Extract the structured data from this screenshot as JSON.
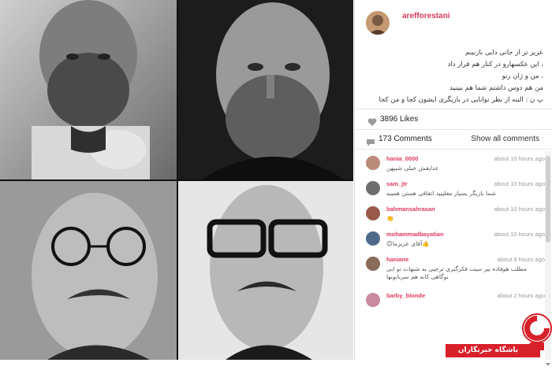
{
  "post": {
    "username": "arefforestani",
    "caption_lines": [
      "عزیز تر از جانی دایی نازنینم",
      "، این عکسهارو در کنار هم قرار داد",
      "، من و ژان رنو",
      "من هم دوس داشتم شما هم ببینید",
      "پ ن : البته از نظر توانایی در بازیگری ایشون کجا و من کجا"
    ],
    "likes_count": "3896 Likes",
    "comments_count": "173 Comments",
    "show_all_label": "Show all comments"
  },
  "comments": [
    {
      "user": "hania_0000",
      "time": "about 10 hours ago",
      "text": "عدایقش خیلی شبیهن",
      "avatar_color": "#b98a78"
    },
    {
      "user": "sam_jtr",
      "time": "about 10 hours ago",
      "text": "شما بازیگر بسیار معلیبید اتفاقی هستن همینه",
      "avatar_color": "#6e6e6e"
    },
    {
      "user": "bahmansahrasan",
      "time": "about 10 hours ago",
      "text": "👏",
      "avatar_color": "#9a5a4a"
    },
    {
      "user": "mohammadbayatian",
      "time": "about 10 hours ago",
      "text": "👍آقای عزیزما😊",
      "avatar_color": "#4e6a8a"
    },
    {
      "user": "haniane",
      "time": "about 8 hours ago",
      "text": "مطلب هوفاده بیر سیت فکرگیری ترجیی به شبهات تو ابی نوگاهی کانه هم سربابونها",
      "avatar_color": "#8a6a5a"
    },
    {
      "user": "barby_blonde",
      "time": "about 2 hours ago",
      "text": "",
      "avatar_color": "#c98aa0"
    }
  ],
  "watermark": {
    "text": "باشگاه خبرنگاران"
  },
  "colors": {
    "username": "#e03a5c",
    "watermark_red": "#d8202a"
  },
  "icons": {
    "likes": "heart-icon",
    "comments": "comment-bubble-icon",
    "watermark": "news-logo-icon"
  }
}
